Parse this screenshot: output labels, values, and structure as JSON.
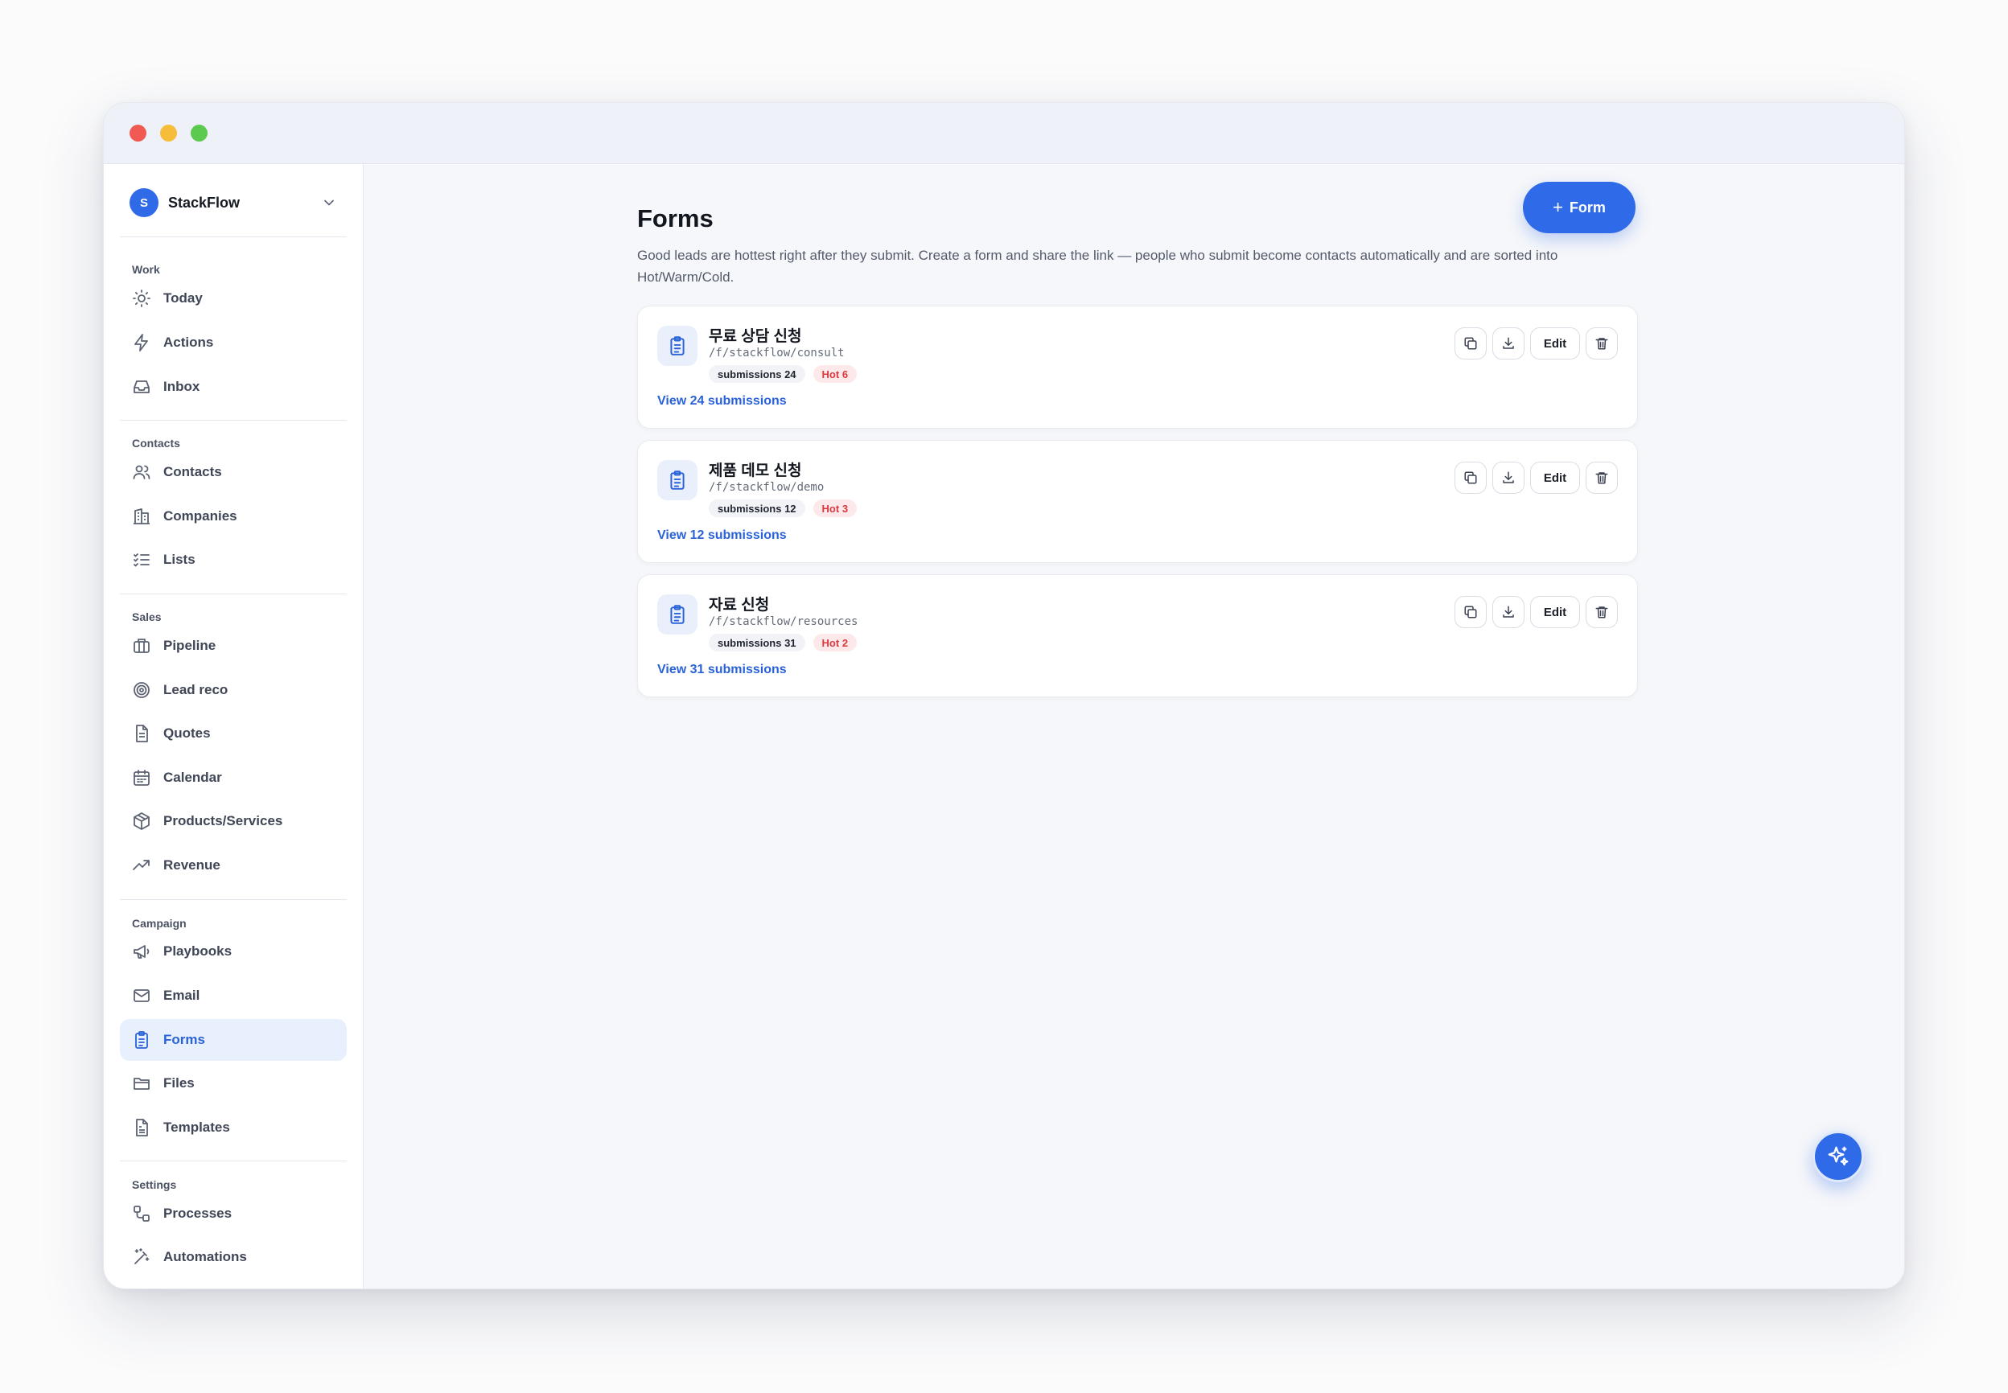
{
  "workspace": {
    "initial": "S",
    "name": "StackFlow"
  },
  "sidebar": {
    "sections": {
      "work": "Work",
      "contacts": "Contacts",
      "sales": "Sales",
      "campaign": "Campaign",
      "settings": "Settings"
    },
    "items": {
      "today": "Today",
      "actions": "Actions",
      "inbox": "Inbox",
      "contacts": "Contacts",
      "companies": "Companies",
      "lists": "Lists",
      "pipeline": "Pipeline",
      "lead_reco": "Lead reco",
      "quotes": "Quotes",
      "calendar": "Calendar",
      "products": "Products/Services",
      "revenue": "Revenue",
      "playbooks": "Playbooks",
      "email": "Email",
      "forms": "Forms",
      "files": "Files",
      "templates": "Templates",
      "processes": "Processes",
      "automations": "Automations"
    },
    "active": "forms"
  },
  "page": {
    "title": "Forms",
    "add_label": "Form",
    "description": "Good leads are hottest right after they submit. Create a form and share the link — people who submit become contacts automatically and are sorted into Hot/Warm/Cold."
  },
  "forms": [
    {
      "title": "무료 상담 신청",
      "path": "/f/stackflow/consult",
      "submissions_badge": "submissions 24",
      "hot_badge": "Hot 6",
      "view_link": "View 24 submissions",
      "edit_label": "Edit"
    },
    {
      "title": "제품 데모 신청",
      "path": "/f/stackflow/demo",
      "submissions_badge": "submissions 12",
      "hot_badge": "Hot 3",
      "view_link": "View 12 submissions",
      "edit_label": "Edit"
    },
    {
      "title": "자료 신청",
      "path": "/f/stackflow/resources",
      "submissions_badge": "submissions 31",
      "hot_badge": "Hot 2",
      "view_link": "View 31 submissions",
      "edit_label": "Edit"
    }
  ],
  "colors": {
    "accent": "#2f6ae8",
    "hot": "#d83a42",
    "active_bg": "#e8effd"
  }
}
